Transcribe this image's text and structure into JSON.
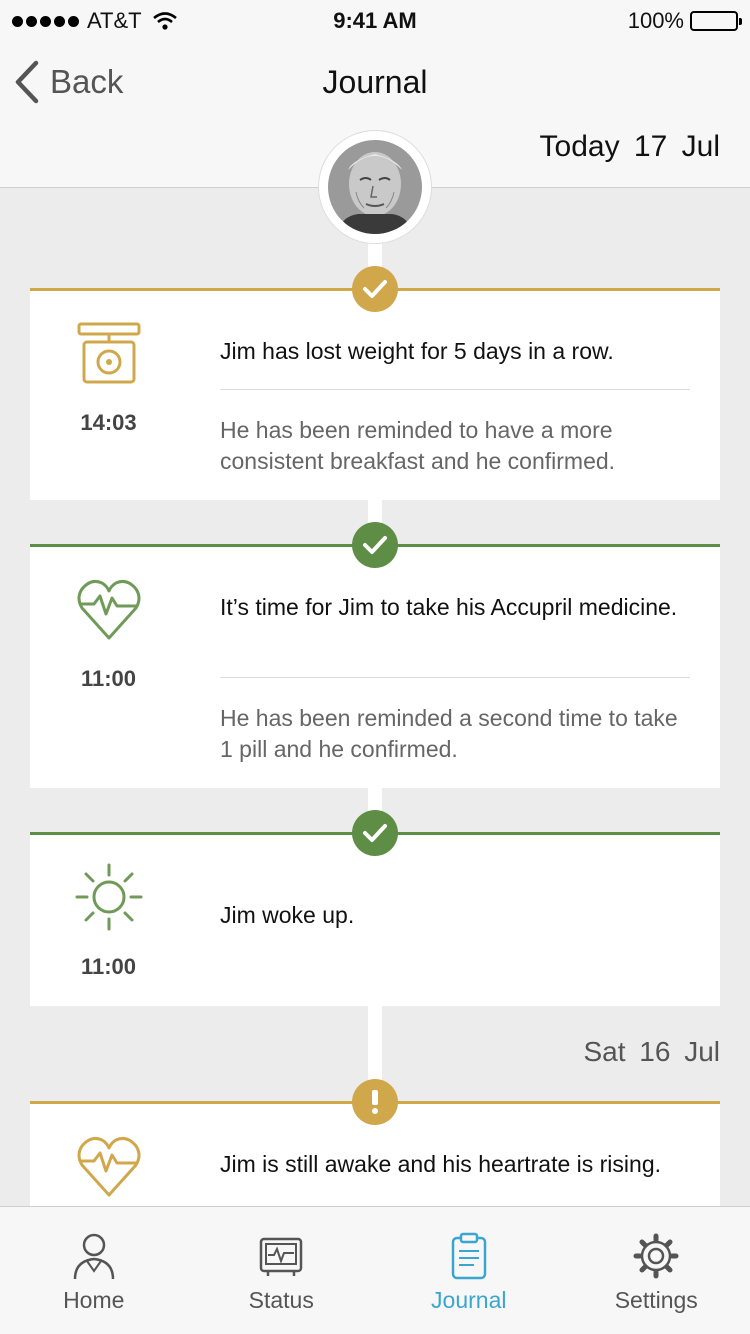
{
  "status_bar": {
    "carrier": "AT&T",
    "time": "9:41 AM",
    "battery": "100%"
  },
  "nav": {
    "back_label": "Back",
    "title": "Journal"
  },
  "today_label": "Today 17 Jul",
  "colors": {
    "gold": "#d0a84b",
    "green": "#5e8e45",
    "tab_active": "#3aa6d0"
  },
  "entries": [
    {
      "icon": "scale-icon",
      "status": "check",
      "color": "gold",
      "time": "14:03",
      "main": "Jim has lost weight for 5 days in a row.",
      "sub": "He has been reminded to have a more consistent breakfast and he confirmed."
    },
    {
      "icon": "heart-icon",
      "status": "check",
      "color": "green",
      "time": "11:00",
      "main": "It’s time for Jim to take his Accupril medicine.",
      "sub": "He has been reminded a second time to take 1 pill and he confirmed."
    },
    {
      "icon": "sun-icon",
      "status": "check",
      "color": "green",
      "time": "11:00",
      "main": "Jim woke up."
    },
    {
      "icon": "heart-icon",
      "status": "warning",
      "color": "gold",
      "main": "Jim is still awake and his heartrate is rising."
    }
  ],
  "date_sat": "Sat 16 Jul",
  "tabs": [
    {
      "label": "Home",
      "icon": "person-icon"
    },
    {
      "label": "Status",
      "icon": "monitor-icon"
    },
    {
      "label": "Journal",
      "icon": "clipboard-icon",
      "active": true
    },
    {
      "label": "Settings",
      "icon": "gear-icon"
    }
  ]
}
